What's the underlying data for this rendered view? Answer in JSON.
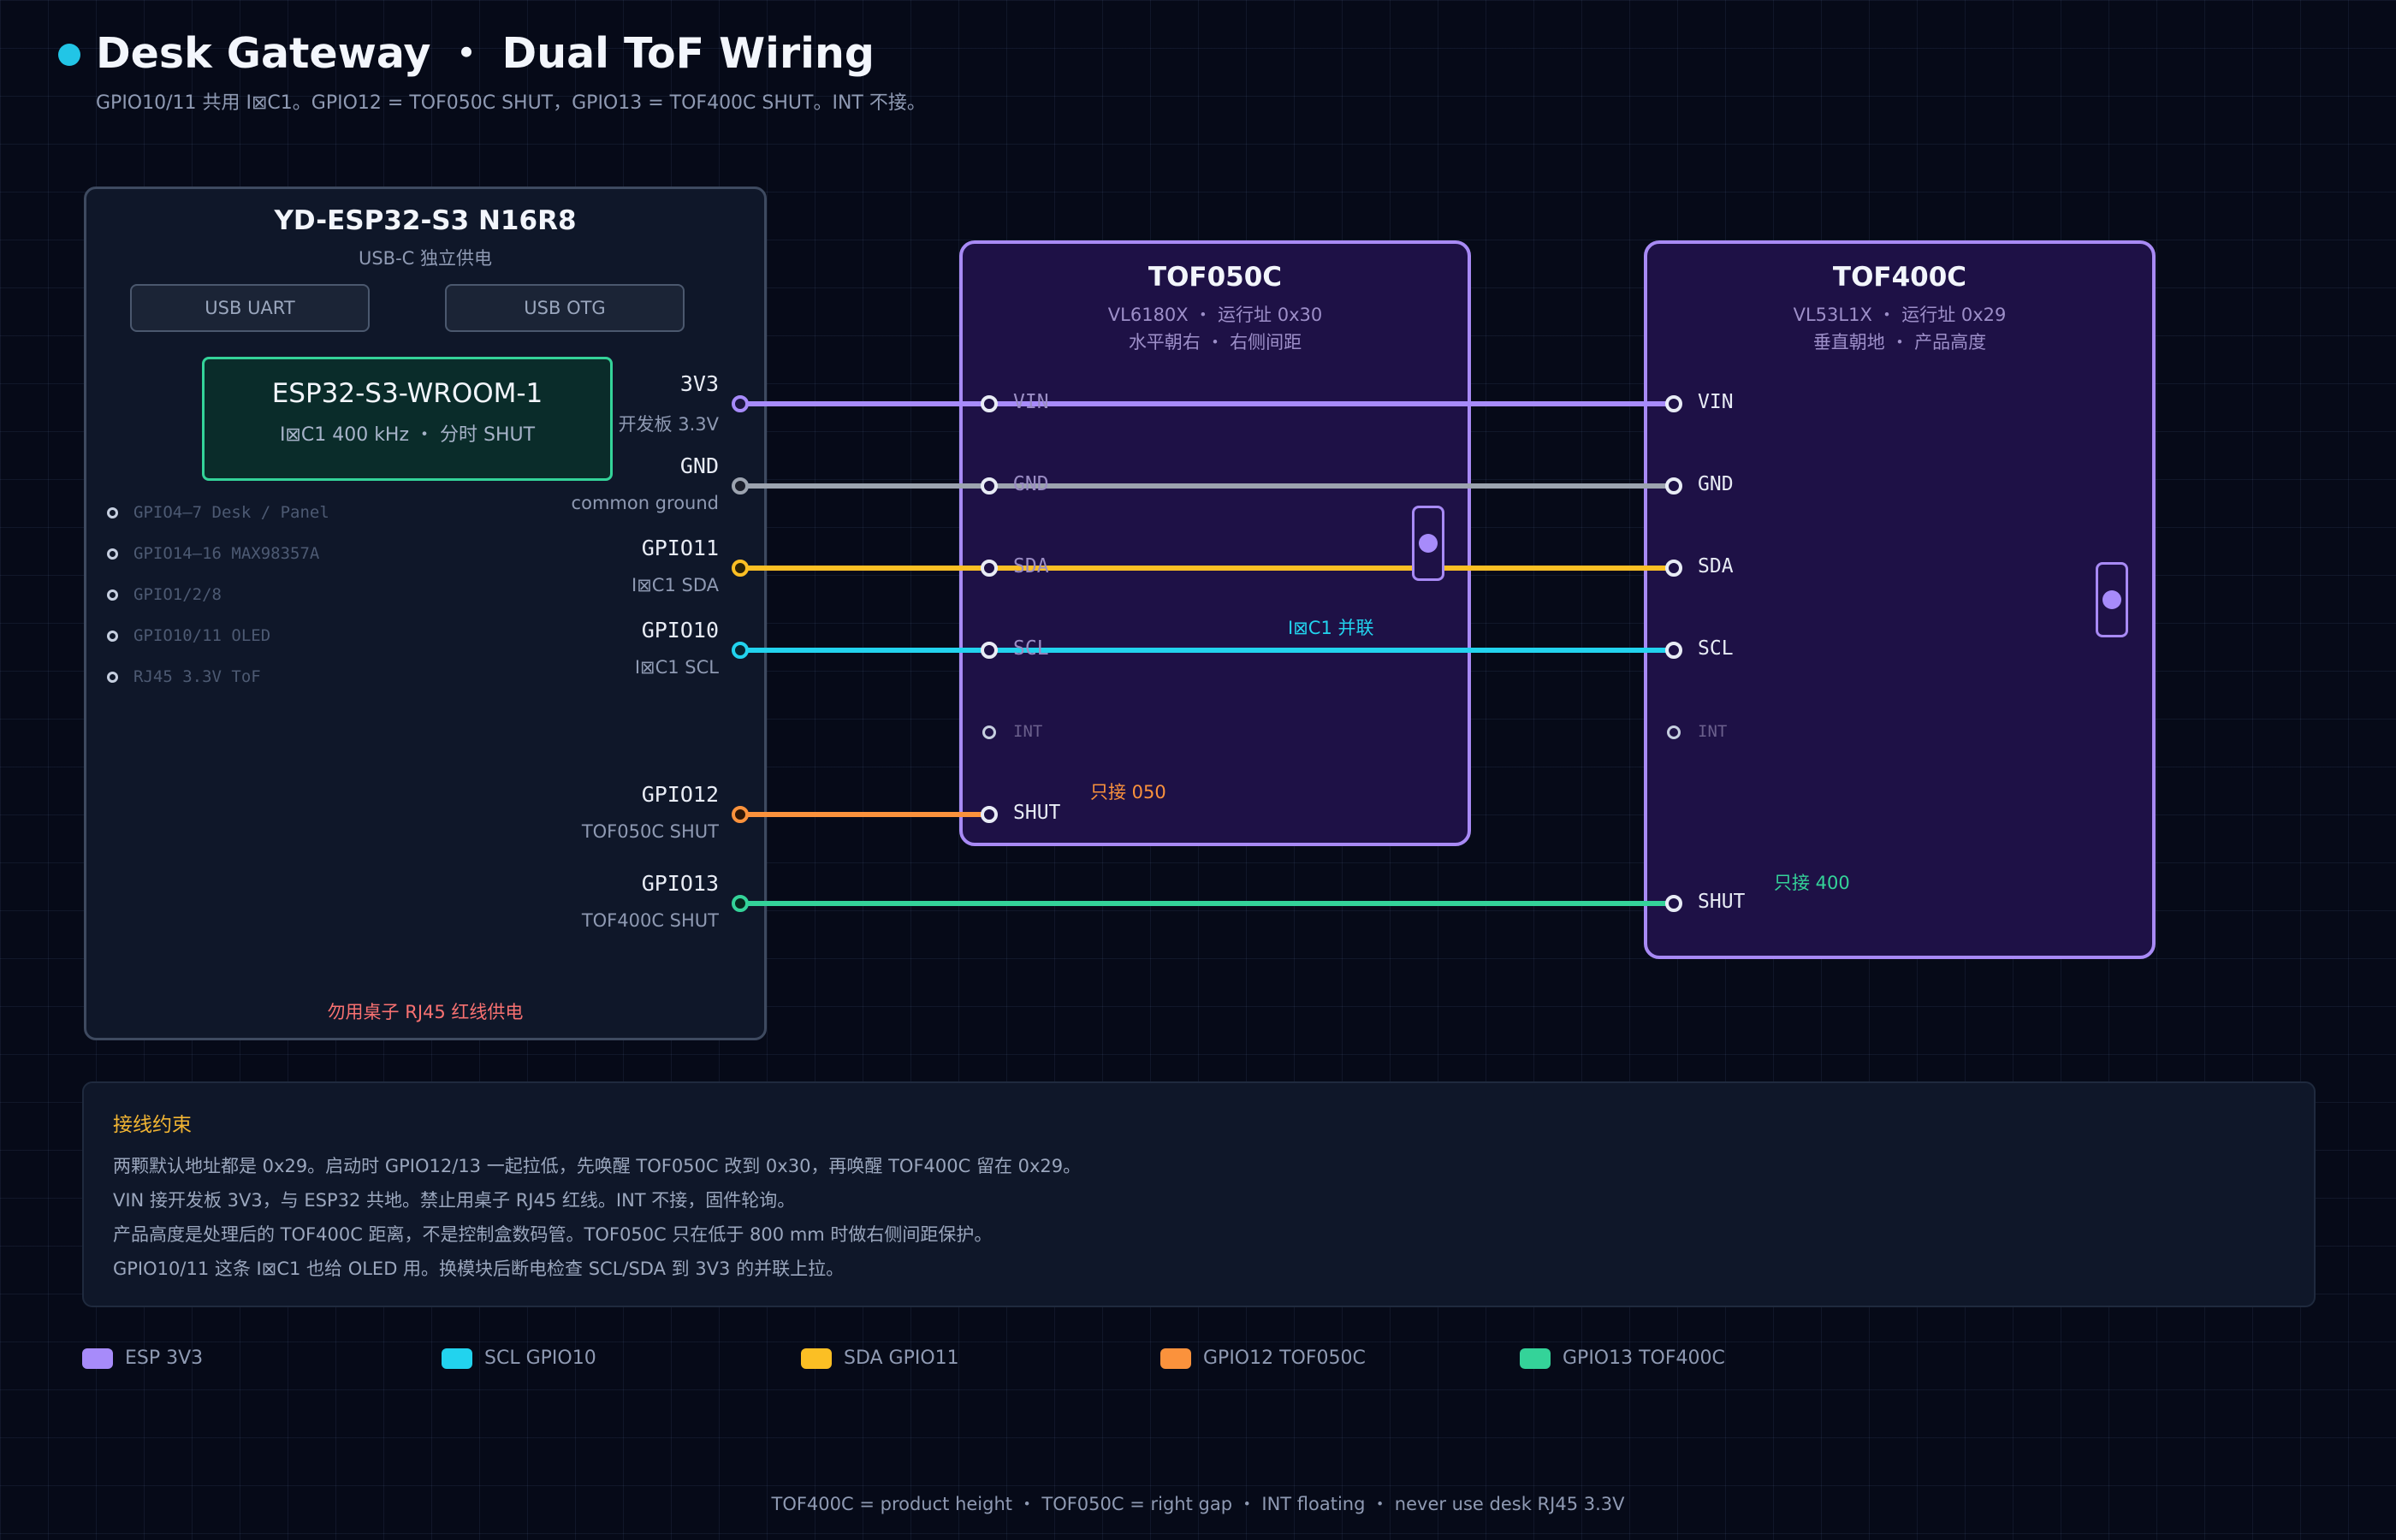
{
  "header": {
    "title": "Desk Gateway ・ Dual ToF Wiring",
    "subtitle": "GPIO10/11 共用 I⊠C1。GPIO12 = TOF050C SHUT，GPIO13 = TOF400C SHUT。INT 不接。"
  },
  "esp": {
    "title": "YD-ESP32-S3  N16R8",
    "subtitle": "USB-C 独立供电",
    "usb_uart": "USB UART",
    "usb_otg": "USB OTG",
    "module_title": "ESP32-S3-WROOM-1",
    "module_sub": "I⊠C1 400 kHz ・ 分时 SHUT",
    "dim_rows": [
      "GPIO4–7  Desk / Panel",
      "GPIO14–16  MAX98357A",
      "GPIO1/2/8",
      "GPIO10/11  OLED",
      "RJ45 3.3V      ToF"
    ],
    "warning": "勿用桌子 RJ45 红线供电",
    "pins": [
      {
        "name": "3V3",
        "sub": "开发板 3.3V"
      },
      {
        "name": "GND",
        "sub": "common ground"
      },
      {
        "name": "GPIO11",
        "sub": "I⊠C1 SDA"
      },
      {
        "name": "GPIO10",
        "sub": "I⊠C1 SCL"
      },
      {
        "name": "GPIO12",
        "sub": "TOF050C SHUT"
      },
      {
        "name": "GPIO13",
        "sub": "TOF400C SHUT"
      }
    ]
  },
  "tof050": {
    "title": "TOF050C",
    "line1": "VL6180X  ・  运行址 0x30",
    "line2": "水平朝右  ・  右侧间距",
    "pins": [
      "VIN",
      "GND",
      "SDA",
      "SCL",
      "INT",
      "SHUT"
    ],
    "annotation": "只接 050"
  },
  "tof400": {
    "title": "TOF400C",
    "line1": "VL53L1X  ・  运行址 0x29",
    "line2": "垂直朝地  ・  产品高度",
    "pins": [
      "VIN",
      "GND",
      "SDA",
      "SCL",
      "INT",
      "SHUT"
    ],
    "annotation": "只接 400"
  },
  "bus_annotation": "I⊠C1 并联",
  "notes": {
    "title": "接线约束",
    "lines": [
      "两颗默认地址都是 0x29。启动时 GPIO12/13 一起拉低，先唤醒 TOF050C 改到 0x30，再唤醒 TOF400C 留在 0x29。",
      "VIN 接开发板 3V3，与 ESP32 共地。禁止用桌子 RJ45 红线。INT 不接，固件轮询。",
      "产品高度是处理后的 TOF400C 距离，不是控制盒数码管。TOF050C 只在低于 800 mm 时做右侧间距保护。",
      "GPIO10/11 这条 I⊠C1 也给 OLED 用。换模块后断电检查 SCL/SDA 到 3V3 的并联上拉。"
    ]
  },
  "legend": [
    {
      "label": "ESP 3V3",
      "color": "#a78bfa"
    },
    {
      "label": "SCL GPIO10",
      "color": "#22d3ee"
    },
    {
      "label": "SDA GPIO11",
      "color": "#fbbf24"
    },
    {
      "label": "GPIO12 TOF050C",
      "color": "#fb923c"
    },
    {
      "label": "GPIO13 TOF400C",
      "color": "#34d399"
    }
  ],
  "footer": "TOF400C = product height  ・  TOF050C = right gap  ・  INT floating  ・  never use desk RJ45 3.3V",
  "colors": {
    "vin": "#a78bfa",
    "gnd": "#9ca3af",
    "sda": "#fbbf24",
    "scl": "#22d3ee",
    "shut050": "#fb923c",
    "shut400": "#34d399",
    "module_border": "#34d399",
    "tof_border": "#a88af5",
    "warning": "#f87171",
    "note_title": "#f2b533"
  }
}
